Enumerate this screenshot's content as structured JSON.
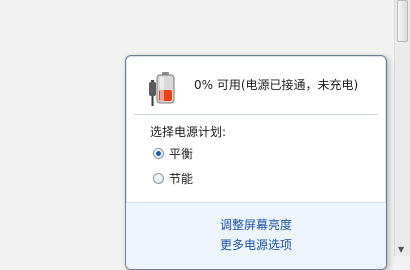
{
  "power_flyout": {
    "status_text": "0% 可用(电源已接通，未充电)",
    "plan_section_title": "选择电源计划:",
    "plans": [
      {
        "label": "平衡",
        "selected": true
      },
      {
        "label": "节能",
        "selected": false
      }
    ],
    "links": {
      "adjust_brightness": "调整屏幕亮度",
      "more_power_options": "更多电源选项"
    }
  },
  "colors": {
    "link": "#1a55a8",
    "battery_charge": "#e8421c",
    "border": "#6f7f92"
  },
  "icons": {
    "battery": "battery-plugged-icon",
    "scroll_down": "scroll-down-arrow-icon"
  }
}
